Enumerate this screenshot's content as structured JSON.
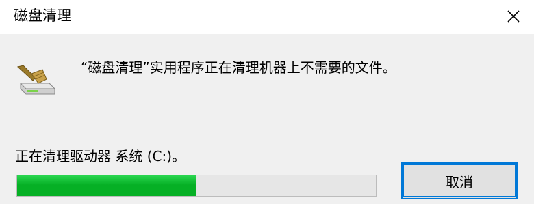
{
  "window": {
    "title": "磁盘清理"
  },
  "dialog": {
    "message": "“磁盘清理”实用程序正在清理机器上不需要的文件。",
    "status": "正在清理驱动器 系统 (C:)。",
    "progress": 0.5,
    "cancel_label": "取消"
  },
  "icons": {
    "app": "disk-cleanup-icon",
    "close": "close-icon"
  },
  "colors": {
    "progress_fill": "#06b025",
    "accent": "#0078d7"
  }
}
